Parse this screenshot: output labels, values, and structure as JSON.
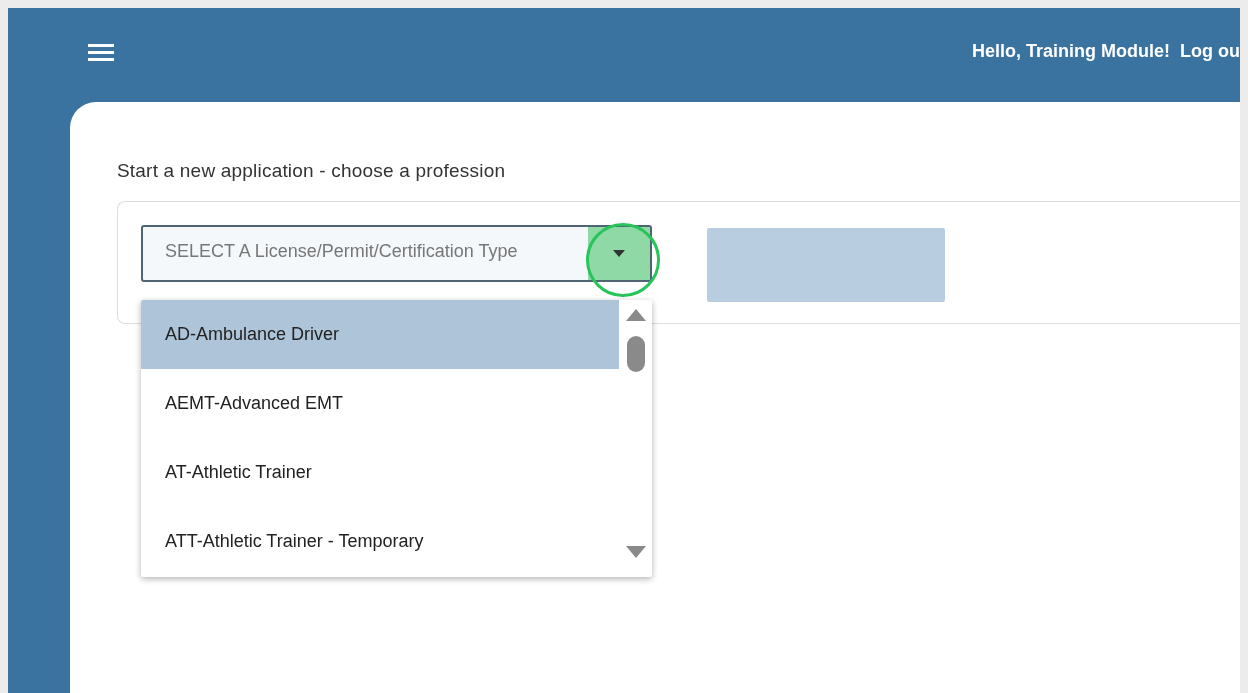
{
  "header": {
    "greeting": "Hello, Training Module!",
    "logout": "Log ou"
  },
  "heading": "Start a new application - choose a profession",
  "select": {
    "placeholder": "SELECT A License/Permit/Certification Type"
  },
  "options": [
    {
      "label": "AD-Ambulance Driver",
      "selected": true
    },
    {
      "label": "AEMT-Advanced EMT",
      "selected": false
    },
    {
      "label": "AT-Athletic Trainer",
      "selected": false
    },
    {
      "label": "ATT-Athletic Trainer - Temporary",
      "selected": false
    }
  ]
}
